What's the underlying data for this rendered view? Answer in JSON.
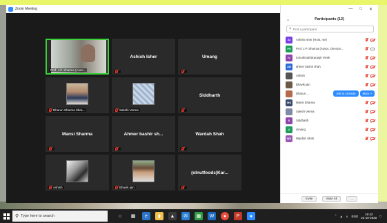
{
  "window": {
    "title": "Zoom Meeting"
  },
  "gallery": {
    "tiles": [
      {
        "label": "Prof. J.P. Sharma (Asso...",
        "center": ""
      },
      {
        "label": "",
        "center": "Ashish Isher"
      },
      {
        "label": "",
        "center": "Umang"
      },
      {
        "label": "Dharun Sharma Shra...",
        "center": ""
      },
      {
        "label": "Sakshi Verma",
        "center": ""
      },
      {
        "label": "",
        "center": "Siddharth"
      },
      {
        "label": "",
        "center": "Mansi Sharma"
      },
      {
        "label": "",
        "center": "Ahmer bashir sh..."
      },
      {
        "label": "",
        "center": "Wardah Shah"
      },
      {
        "label": "Ashish",
        "center": ""
      },
      {
        "label": "Bhavik jain",
        "center": ""
      },
      {
        "label": "",
        "center": "(oInutfoods)Kar..."
      }
    ]
  },
  "panel": {
    "title": "Participants (12)",
    "search_placeholder": "Find a participant",
    "participants": [
      {
        "initials": "AI",
        "name": "Ashish Isher (Host, me)",
        "color": "#7b3fe4"
      },
      {
        "initials": "PS",
        "name": "Prof. J.P. Sharma (Assoc. Director...",
        "color": "#1a9e5a"
      },
      {
        "initials": "IV",
        "name": "(oInutfoods)Karanjit Vivek",
        "color": "#8e44ad"
      },
      {
        "initials": "AB",
        "name": "ahmer bashir shah",
        "color": "#2d6bd6"
      },
      {
        "initials": "",
        "name": "Ashish",
        "color": "#555555"
      },
      {
        "initials": "",
        "name": "Bhavik jain",
        "color": "#6b5a48"
      },
      {
        "initials": "",
        "name": "Dharun ...",
        "color": "#b56a4a"
      },
      {
        "initials": "MS",
        "name": "Mansi Sharma",
        "color": "#3a4a6b"
      },
      {
        "initials": "",
        "name": "Sakshi Verma",
        "color": "#7f8aa8"
      },
      {
        "initials": "S",
        "name": "Siddharth",
        "color": "#8e44ad"
      },
      {
        "initials": "U",
        "name": "Umang",
        "color": "#1a9e5a"
      },
      {
        "initials": "WS",
        "name": "Wardah Shah",
        "color": "#9b59b6"
      }
    ],
    "ask_unmute": "Ask to Unmute",
    "more": "More >",
    "footer": {
      "invite": "Invite",
      "mute_all": "Mute All",
      "more": "..."
    }
  },
  "taskbar": {
    "search_placeholder": "Type here to search",
    "lang": "ENG",
    "time": "16:42",
    "date": "22-10-2020"
  }
}
